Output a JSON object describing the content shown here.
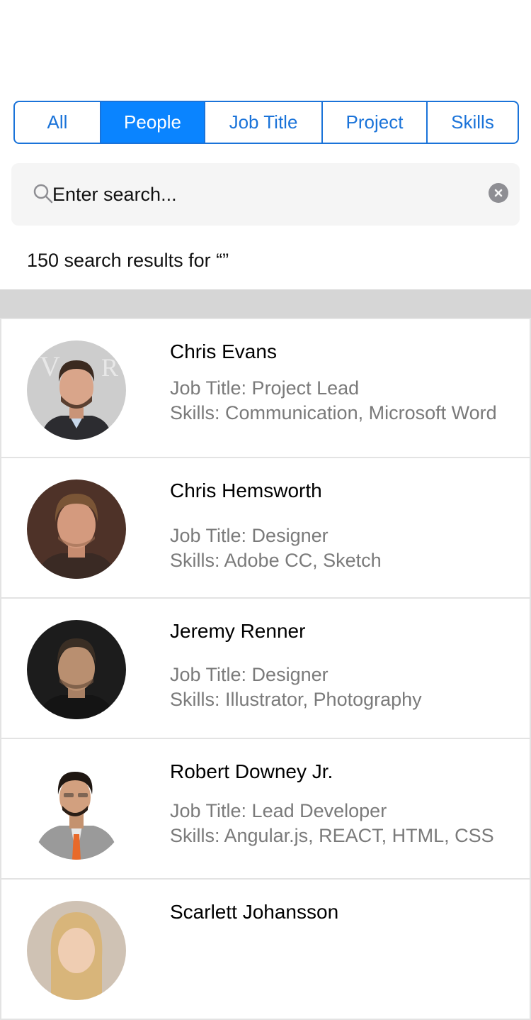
{
  "tabs": [
    {
      "label": "All",
      "active": false
    },
    {
      "label": "People",
      "active": true
    },
    {
      "label": "Job Title",
      "active": false
    },
    {
      "label": "Project",
      "active": false
    },
    {
      "label": "Skills",
      "active": false
    }
  ],
  "search": {
    "placeholder": "Enter search...",
    "value": ""
  },
  "results_text": "150 search results for “”",
  "people": [
    {
      "name": "Chris Evans",
      "job_title": "Job Title: Project Lead",
      "skills": "Skills: Communication, Microsoft Word",
      "avatar_colors": {
        "bg": "#c9c9c9",
        "skin": "#d9a58a",
        "hair": "#3b2a20",
        "shirt": "#2c2c30"
      }
    },
    {
      "name": "Chris Hemsworth",
      "job_title": "Job Title: Designer",
      "skills": "Skills: Adobe CC, Sketch",
      "avatar_colors": {
        "bg": "#5a3a2e",
        "skin": "#d49a7e",
        "hair": "#7a5536",
        "shirt": "#3a2a24"
      }
    },
    {
      "name": "Jeremy Renner",
      "job_title": "Job Title: Designer",
      "skills": "Skills: Illustrator, Photography",
      "avatar_colors": {
        "bg": "#1c1c1c",
        "skin": "#b98f70",
        "hair": "#3a2e24",
        "shirt": "#141414"
      }
    },
    {
      "name": "Robert Downey Jr.",
      "job_title": "Job Title: Lead Developer",
      "skills": "Skills: Angular.js, REACT, HTML, CSS",
      "avatar_colors": {
        "bg": "#ffffff",
        "skin": "#d2a07f",
        "hair": "#1f1712",
        "shirt": "#9a9a9a"
      }
    },
    {
      "name": "Scarlett Johansson",
      "job_title": "",
      "skills": "",
      "avatar_colors": {
        "bg": "#cfc2b4",
        "skin": "#efcdb2",
        "hair": "#d8b57a",
        "shirt": "#888888"
      }
    }
  ],
  "colors": {
    "accent": "#0a84ff",
    "segment_border": "#1a73d9",
    "detail_text": "#7a7a7a"
  }
}
